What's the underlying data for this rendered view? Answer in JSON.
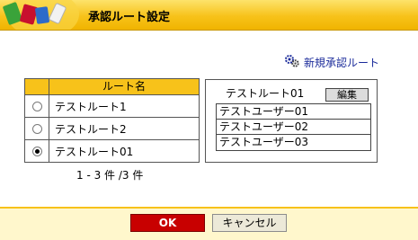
{
  "header": {
    "title": "承認ルート設定",
    "logo_icon": "books-logo-icon"
  },
  "new_route": {
    "label": "新規承認ルート",
    "icon": "gears-icon"
  },
  "route_table": {
    "column_header": "ルート名",
    "rows": [
      {
        "name": "テストルート1",
        "selected": false
      },
      {
        "name": "テストルート2",
        "selected": false
      },
      {
        "name": "テストルート01",
        "selected": true
      }
    ],
    "count_text": "1 - 3 件 /3 件"
  },
  "route_detail": {
    "title": "テストルート01",
    "edit_label": "編集",
    "users": [
      "テストユーザー01",
      "テストユーザー02",
      "テストユーザー03"
    ]
  },
  "footer": {
    "ok_label": "OK",
    "cancel_label": "キャンセル"
  },
  "colors": {
    "accent": "#f7c21a",
    "ok_button": "#c80000",
    "link": "#1a2a9a"
  }
}
